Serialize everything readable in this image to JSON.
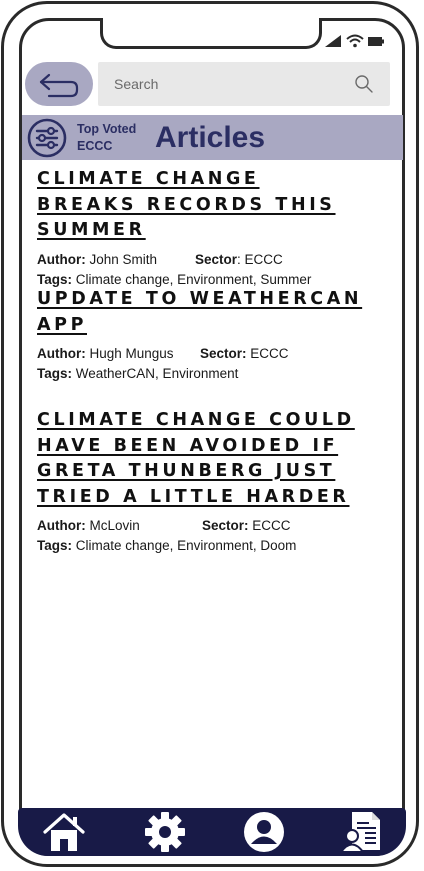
{
  "search": {
    "placeholder": "Search"
  },
  "header": {
    "filter_label_line1": "Top Voted",
    "filter_label_line2": "ECCC",
    "title": "Articles"
  },
  "colors": {
    "accent": "#a9a8c2",
    "title_text": "#2b2e63",
    "nav_background": "#181a47"
  },
  "articles": [
    {
      "title": "CLIMATE CHANGE BREAKS RECORDS THIS SUMMER",
      "author_label": "Author:",
      "author": "John Smith",
      "sector_label": "Sector",
      "sector": ": ECCC",
      "tags_label": "Tags:",
      "tags": "Climate change, Environment, Summer"
    },
    {
      "title": "UPDATE TO WEATHERCAN APP",
      "author_label": "Author:",
      "author": "Hugh Mungus",
      "sector_label": "Sector:",
      "sector": "ECCC",
      "tags_label": "Tags:",
      "tags": "WeatherCAN, Environment"
    },
    {
      "title": "CLIMATE CHANGE COULD HAVE BEEN AVOIDED IF GRETA THUNBERG JUST TRIED A LITTLE HARDER",
      "author_label": "Author:",
      "author": "McLovin",
      "sector_label": "Sector:",
      "sector": "ECCC",
      "tags_label": "Tags:",
      "tags": "Climate change, Environment, Doom"
    }
  ],
  "icons": {
    "back": "back-arrow-icon",
    "search": "search-icon",
    "filter": "sliders-icon",
    "nav": [
      "home-icon",
      "gear-icon",
      "user-icon",
      "document-icon"
    ],
    "status": [
      "signal-icon",
      "wifi-icon",
      "battery-icon"
    ]
  }
}
